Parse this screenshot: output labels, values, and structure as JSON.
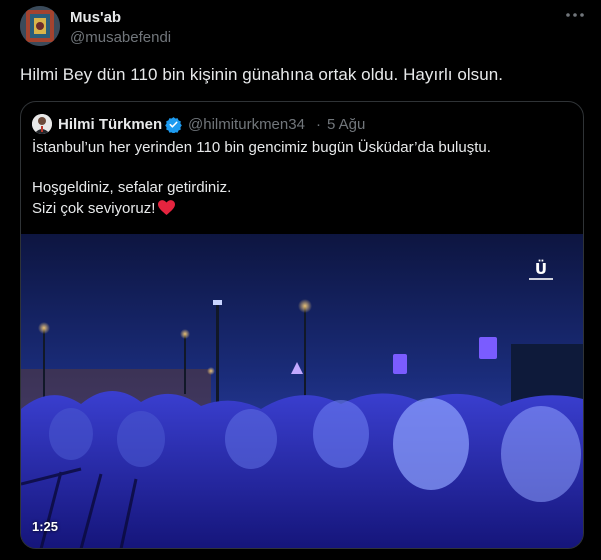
{
  "tweet": {
    "author": {
      "name": "Mus'ab",
      "handle": "@musabefendi"
    },
    "text": "Hilmi Bey dün 110 bin kişinin günahına ortak oldu. Hayırlı olsun.",
    "more_icon": "more-horizontal-icon"
  },
  "quoted_tweet": {
    "author": {
      "name": "Hilmi Türkmen",
      "verified": true,
      "verified_icon": "verified-badge-icon",
      "handle": "@hilmiturkmen34",
      "separator": "·",
      "date": "5 Ağu"
    },
    "lines": [
      "İstanbul’un her yerinden 110 bin gencimiz bugün Üsküdar’da buluştu.",
      "Hoşgeldiniz, sefalar getirdiniz.",
      "Sizi çok seviyoruz!"
    ],
    "emoji_icon": "red-heart-icon",
    "media": {
      "type": "video",
      "description_icon": "concert-crowd-video",
      "duration": "1:25",
      "watermark_logo": "uskudar-logo"
    }
  },
  "colors": {
    "background": "#000000",
    "text": "#e7e9ea",
    "secondary_text": "#71767b",
    "border": "#2f3336",
    "verified": "#1d9bf0",
    "heart": "#f91880"
  }
}
